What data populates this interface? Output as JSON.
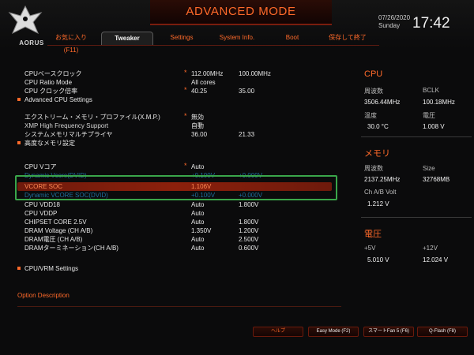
{
  "header": {
    "title": "ADVANCED MODE",
    "logo_text": "AORUS",
    "date": "07/26/2020",
    "day": "Sunday",
    "time": "17:42"
  },
  "tabs": [
    {
      "label": "お気に入り (F11)"
    },
    {
      "label": "Tweaker"
    },
    {
      "label": "Settings"
    },
    {
      "label": "System Info."
    },
    {
      "label": "Boot"
    },
    {
      "label": "保存して終了"
    }
  ],
  "settings": [
    {
      "label": "CPUベースクロック",
      "v1": "112.00MHz",
      "v2": "100.00MHz"
    },
    {
      "label": "CPU Ratio Mode",
      "v1": "All cores",
      "v2": ""
    },
    {
      "label": "CPU クロック倍率",
      "v1": "40.25",
      "v2": "35.00"
    },
    {
      "label": "Advanced CPU Settings",
      "v1": "",
      "v2": ""
    },
    {
      "label": "エクストリーム・メモリ・プロファイル(X.M.P.)",
      "v1": "無効",
      "v2": ""
    },
    {
      "label": "XMP High Frequency Support",
      "v1": "自動",
      "v2": ""
    },
    {
      "label": "システムメモリマルチプライヤ",
      "v1": "36.00",
      "v2": "21.33"
    },
    {
      "label": "高度なメモリ設定",
      "v1": "",
      "v2": ""
    },
    {
      "label": "CPU Vコア",
      "v1": "Auto",
      "v2": ""
    },
    {
      "label": "Dynamic Vcore(DVID)",
      "v1": "+0.100V",
      "v2": "+0.000V"
    },
    {
      "label": "VCORE SOC",
      "v1": "1.106V",
      "v2": ""
    },
    {
      "label": "Dynamic VCORE SOC(DVID)",
      "v1": "+0.100V",
      "v2": "+0.000V"
    },
    {
      "label": "CPU VDD18",
      "v1": "Auto",
      "v2": "1.800V"
    },
    {
      "label": "CPU VDDP",
      "v1": "Auto",
      "v2": ""
    },
    {
      "label": "CHIPSET CORE 2.5V",
      "v1": "Auto",
      "v2": "1.800V"
    },
    {
      "label": "DRAM Voltage (CH A/B)",
      "v1": "1.350V",
      "v2": "1.200V"
    },
    {
      "label": "DRAM電圧 (CH A/B)",
      "v1": "Auto",
      "v2": "2.500V"
    },
    {
      "label": "DRAMターミネーション(CH A/B)",
      "v1": "Auto",
      "v2": "0.600V"
    },
    {
      "label": "CPU/VRM Settings",
      "v1": "",
      "v2": ""
    }
  ],
  "option_description": "Option Description",
  "side": {
    "cpu": {
      "title": "CPU",
      "freq_label": "周波数",
      "freq_value": "3506.44MHz",
      "bclk_label": "BCLK",
      "bclk_value": "100.18MHz",
      "temp_label": "温度",
      "temp_value": "30.0 °C",
      "volt_label": "電圧",
      "volt_value": "1.008 V"
    },
    "memory": {
      "title": "メモリ",
      "freq_label": "周波数",
      "freq_value": "2137.25MHz",
      "size_label": "Size",
      "size_value": "32768MB",
      "chab_label": "Ch A/B Volt",
      "chab_value": "1.212 V"
    },
    "voltage": {
      "title": "電圧",
      "p5_label": "+5V",
      "p5_value": "5.010 V",
      "p12_label": "+12V",
      "p12_value": "12.024 V"
    }
  },
  "bottom_buttons": [
    {
      "label": "ヘルプ"
    },
    {
      "label": "Easy Mode (F2)"
    },
    {
      "label": "スマートFan 5 (F6)"
    },
    {
      "label": "Q-Flash (F8)"
    }
  ],
  "colors": {
    "accent": "#ff6a2a",
    "highlight": "#8c200c",
    "select_outline": "#3aa64a",
    "muted_text": "#1f6f9e"
  }
}
